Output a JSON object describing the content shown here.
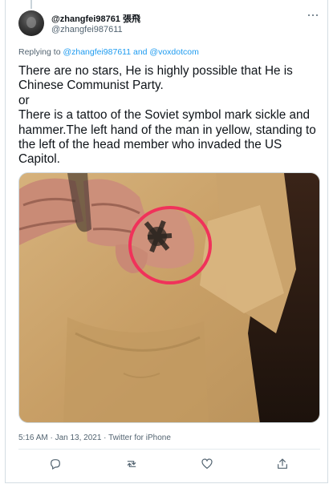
{
  "tweet": {
    "display_name": "@zhangfei98761 張飛",
    "handle": "@zhangfei987611",
    "reply": {
      "prefix": "Replying to",
      "targets": "@zhangfei987611 and @voxdotcom"
    },
    "text": "There are no stars, He is highly possible that He is Chinese Communist Party.\nor\nThere is a tattoo of the Soviet symbol mark sickle and hammer.The left hand of the man in yellow, standing to the left of the head member who invaded the US Capitol.",
    "meta": "5:16 AM · Jan 13, 2021 · Twitter for iPhone"
  },
  "icons": {
    "more": "more-horizontal-icon",
    "reply": "reply-icon",
    "retweet": "retweet-icon",
    "like": "heart-icon",
    "share": "share-icon"
  },
  "colors": {
    "link": "#1d9bf0",
    "secondary_text": "#536471",
    "annotation_circle": "#f0325a"
  }
}
